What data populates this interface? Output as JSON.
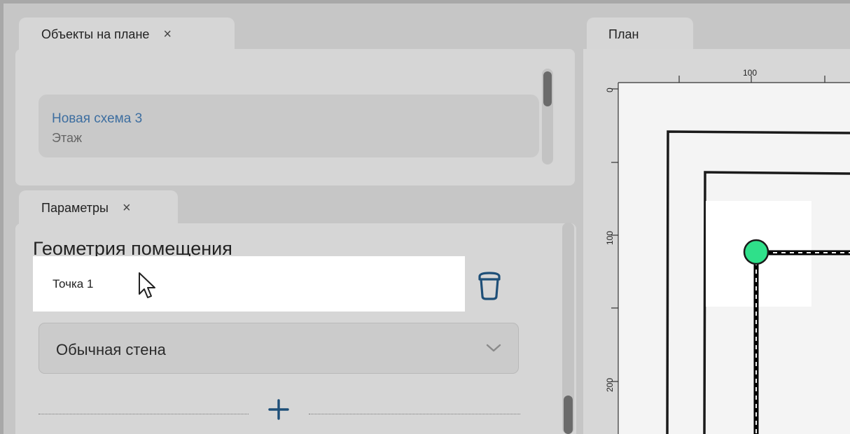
{
  "objects_panel": {
    "tab_label": "Объекты на плане",
    "close_glyph": "×",
    "item": {
      "name": "Новая схема 3",
      "type": "Этаж"
    }
  },
  "params_panel": {
    "tab_label": "Параметры",
    "close_glyph": "×",
    "section_title": "Геометрия помещения",
    "point_label": "Точка 1",
    "wall_type": "Обычная стена",
    "add_glyph": "+"
  },
  "plan_panel": {
    "tab_label": "План",
    "ruler": {
      "x_labels": [
        "100"
      ],
      "y_labels": [
        "0",
        "100",
        "200"
      ]
    }
  },
  "colors": {
    "link": "#3d6ea0",
    "accent_icon": "#1e4f78",
    "point_marker": "#2fe08a"
  },
  "icons": [
    "close-icon",
    "trash-icon",
    "chevron-down-icon",
    "plus-icon",
    "mouse-cursor-icon"
  ]
}
